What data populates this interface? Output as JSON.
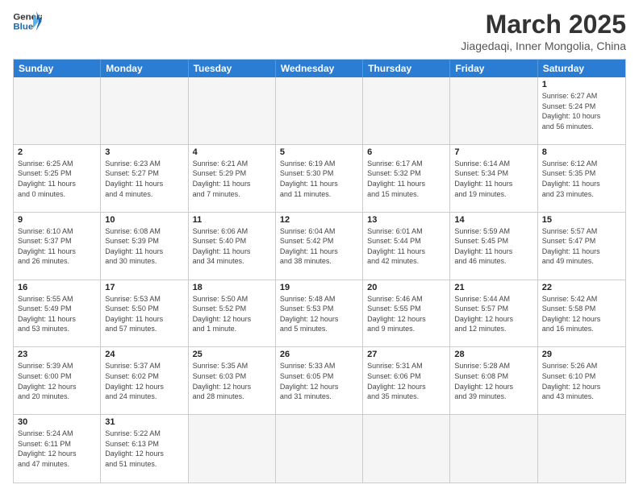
{
  "header": {
    "logo_general": "General",
    "logo_blue": "Blue",
    "month_year": "March 2025",
    "location": "Jiagedaqi, Inner Mongolia, China"
  },
  "days_of_week": [
    "Sunday",
    "Monday",
    "Tuesday",
    "Wednesday",
    "Thursday",
    "Friday",
    "Saturday"
  ],
  "weeks": [
    [
      {
        "day": "",
        "info": ""
      },
      {
        "day": "",
        "info": ""
      },
      {
        "day": "",
        "info": ""
      },
      {
        "day": "",
        "info": ""
      },
      {
        "day": "",
        "info": ""
      },
      {
        "day": "",
        "info": ""
      },
      {
        "day": "1",
        "info": "Sunrise: 6:27 AM\nSunset: 5:24 PM\nDaylight: 10 hours\nand 56 minutes."
      }
    ],
    [
      {
        "day": "2",
        "info": "Sunrise: 6:25 AM\nSunset: 5:25 PM\nDaylight: 11 hours\nand 0 minutes."
      },
      {
        "day": "3",
        "info": "Sunrise: 6:23 AM\nSunset: 5:27 PM\nDaylight: 11 hours\nand 4 minutes."
      },
      {
        "day": "4",
        "info": "Sunrise: 6:21 AM\nSunset: 5:29 PM\nDaylight: 11 hours\nand 7 minutes."
      },
      {
        "day": "5",
        "info": "Sunrise: 6:19 AM\nSunset: 5:30 PM\nDaylight: 11 hours\nand 11 minutes."
      },
      {
        "day": "6",
        "info": "Sunrise: 6:17 AM\nSunset: 5:32 PM\nDaylight: 11 hours\nand 15 minutes."
      },
      {
        "day": "7",
        "info": "Sunrise: 6:14 AM\nSunset: 5:34 PM\nDaylight: 11 hours\nand 19 minutes."
      },
      {
        "day": "8",
        "info": "Sunrise: 6:12 AM\nSunset: 5:35 PM\nDaylight: 11 hours\nand 23 minutes."
      }
    ],
    [
      {
        "day": "9",
        "info": "Sunrise: 6:10 AM\nSunset: 5:37 PM\nDaylight: 11 hours\nand 26 minutes."
      },
      {
        "day": "10",
        "info": "Sunrise: 6:08 AM\nSunset: 5:39 PM\nDaylight: 11 hours\nand 30 minutes."
      },
      {
        "day": "11",
        "info": "Sunrise: 6:06 AM\nSunset: 5:40 PM\nDaylight: 11 hours\nand 34 minutes."
      },
      {
        "day": "12",
        "info": "Sunrise: 6:04 AM\nSunset: 5:42 PM\nDaylight: 11 hours\nand 38 minutes."
      },
      {
        "day": "13",
        "info": "Sunrise: 6:01 AM\nSunset: 5:44 PM\nDaylight: 11 hours\nand 42 minutes."
      },
      {
        "day": "14",
        "info": "Sunrise: 5:59 AM\nSunset: 5:45 PM\nDaylight: 11 hours\nand 46 minutes."
      },
      {
        "day": "15",
        "info": "Sunrise: 5:57 AM\nSunset: 5:47 PM\nDaylight: 11 hours\nand 49 minutes."
      }
    ],
    [
      {
        "day": "16",
        "info": "Sunrise: 5:55 AM\nSunset: 5:49 PM\nDaylight: 11 hours\nand 53 minutes."
      },
      {
        "day": "17",
        "info": "Sunrise: 5:53 AM\nSunset: 5:50 PM\nDaylight: 11 hours\nand 57 minutes."
      },
      {
        "day": "18",
        "info": "Sunrise: 5:50 AM\nSunset: 5:52 PM\nDaylight: 12 hours\nand 1 minute."
      },
      {
        "day": "19",
        "info": "Sunrise: 5:48 AM\nSunset: 5:53 PM\nDaylight: 12 hours\nand 5 minutes."
      },
      {
        "day": "20",
        "info": "Sunrise: 5:46 AM\nSunset: 5:55 PM\nDaylight: 12 hours\nand 9 minutes."
      },
      {
        "day": "21",
        "info": "Sunrise: 5:44 AM\nSunset: 5:57 PM\nDaylight: 12 hours\nand 12 minutes."
      },
      {
        "day": "22",
        "info": "Sunrise: 5:42 AM\nSunset: 5:58 PM\nDaylight: 12 hours\nand 16 minutes."
      }
    ],
    [
      {
        "day": "23",
        "info": "Sunrise: 5:39 AM\nSunset: 6:00 PM\nDaylight: 12 hours\nand 20 minutes."
      },
      {
        "day": "24",
        "info": "Sunrise: 5:37 AM\nSunset: 6:02 PM\nDaylight: 12 hours\nand 24 minutes."
      },
      {
        "day": "25",
        "info": "Sunrise: 5:35 AM\nSunset: 6:03 PM\nDaylight: 12 hours\nand 28 minutes."
      },
      {
        "day": "26",
        "info": "Sunrise: 5:33 AM\nSunset: 6:05 PM\nDaylight: 12 hours\nand 31 minutes."
      },
      {
        "day": "27",
        "info": "Sunrise: 5:31 AM\nSunset: 6:06 PM\nDaylight: 12 hours\nand 35 minutes."
      },
      {
        "day": "28",
        "info": "Sunrise: 5:28 AM\nSunset: 6:08 PM\nDaylight: 12 hours\nand 39 minutes."
      },
      {
        "day": "29",
        "info": "Sunrise: 5:26 AM\nSunset: 6:10 PM\nDaylight: 12 hours\nand 43 minutes."
      }
    ],
    [
      {
        "day": "30",
        "info": "Sunrise: 5:24 AM\nSunset: 6:11 PM\nDaylight: 12 hours\nand 47 minutes."
      },
      {
        "day": "31",
        "info": "Sunrise: 5:22 AM\nSunset: 6:13 PM\nDaylight: 12 hours\nand 51 minutes."
      },
      {
        "day": "",
        "info": ""
      },
      {
        "day": "",
        "info": ""
      },
      {
        "day": "",
        "info": ""
      },
      {
        "day": "",
        "info": ""
      },
      {
        "day": "",
        "info": ""
      }
    ]
  ]
}
